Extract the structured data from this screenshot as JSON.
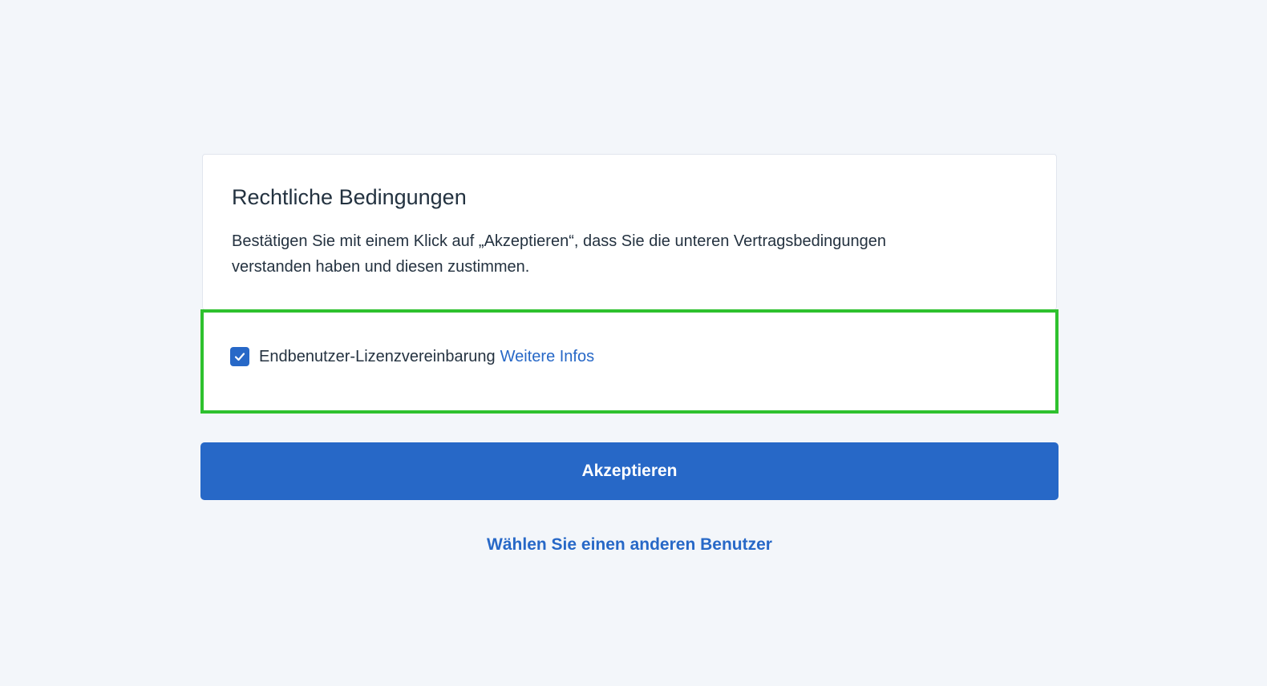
{
  "legal": {
    "title": "Rechtliche Bedingungen",
    "description": "Bestätigen Sie mit einem Klick auf „Akzeptieren“, dass Sie die unteren Vertragsbedingungen verstanden haben und diesen zustimmen."
  },
  "agreement": {
    "checked": true,
    "label": "Endbenutzer-Lizenzvereinbarung",
    "link_text": "Weitere Infos"
  },
  "actions": {
    "accept_label": "Akzeptieren",
    "other_user_label": "Wählen Sie einen anderen Benutzer"
  },
  "colors": {
    "accent": "#2768c7",
    "highlight": "#2ec12e",
    "background": "#f3f6fa"
  },
  "icons": {
    "checkbox": "check-icon"
  }
}
